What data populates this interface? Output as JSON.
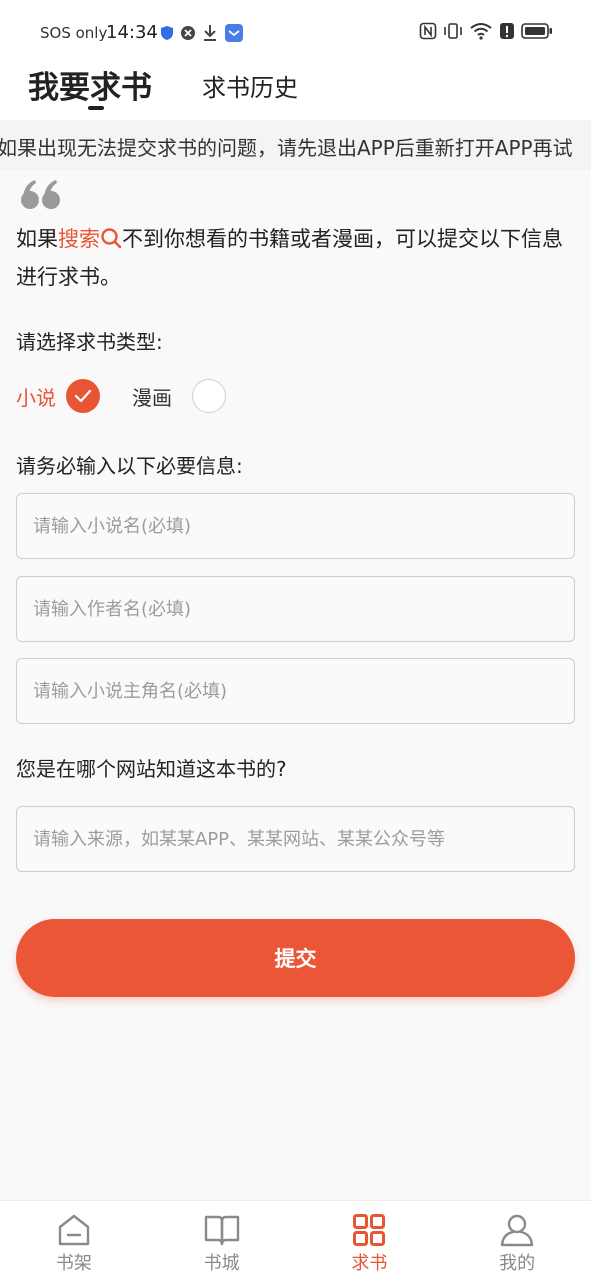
{
  "status_bar": {
    "carrier": "SOS only",
    "time": "14:34"
  },
  "tabs": {
    "active": "我要求书",
    "inactive": "求书历史"
  },
  "notice": "如果出现无法提交求书的问题，请先退出APP后重新打开APP再试",
  "intro": {
    "before": "如果",
    "highlight": "搜索",
    "after": "不到你想看的书籍或者漫画，可以提交以下信息进行求书。"
  },
  "type_section": {
    "label": "请选择求书类型:",
    "options": [
      {
        "label": "小说",
        "selected": true
      },
      {
        "label": "漫画",
        "selected": false
      }
    ]
  },
  "required_section": {
    "label": "请务必输入以下必要信息:",
    "fields": [
      {
        "placeholder": "请输入小说名(必填)"
      },
      {
        "placeholder": "请输入作者名(必填)"
      },
      {
        "placeholder": "请输入小说主角名(必填)"
      }
    ]
  },
  "source_section": {
    "label": "您是在哪个网站知道这本书的?",
    "placeholder": "请输入来源，如某某APP、某某网站、某某公众号等"
  },
  "submit_label": "提交",
  "bottom_nav": [
    {
      "label": "书架",
      "icon": "home-icon",
      "active": false
    },
    {
      "label": "书城",
      "icon": "book-icon",
      "active": false
    },
    {
      "label": "求书",
      "icon": "grid-icon",
      "active": true
    },
    {
      "label": "我的",
      "icon": "person-icon",
      "active": false
    }
  ],
  "colors": {
    "accent": "#e85535",
    "background": "#f9f9f9"
  }
}
